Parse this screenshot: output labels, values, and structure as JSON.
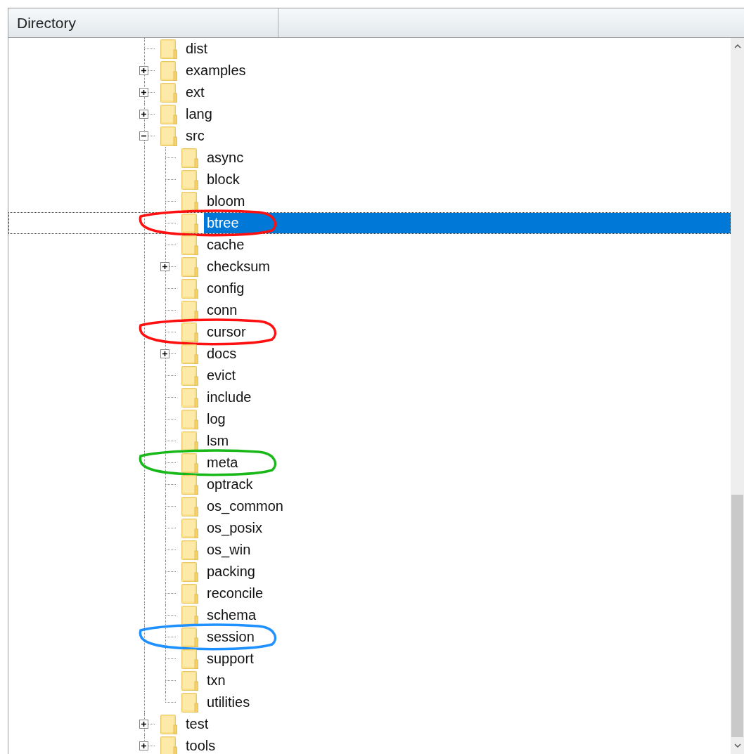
{
  "header": {
    "columns": [
      "Directory"
    ]
  },
  "tree": {
    "items": [
      {
        "name": "dist",
        "selected": false
      },
      {
        "name": "examples",
        "expanded": false,
        "selected": false
      },
      {
        "name": "ext",
        "expanded": false,
        "selected": false
      },
      {
        "name": "lang",
        "expanded": false,
        "selected": false
      },
      {
        "name": "src",
        "expanded": true,
        "selected": false,
        "children": [
          {
            "name": "async",
            "selected": false
          },
          {
            "name": "block",
            "selected": false
          },
          {
            "name": "bloom",
            "selected": false
          },
          {
            "name": "btree",
            "selected": true,
            "circle": {
              "color": "#ff1010"
            }
          },
          {
            "name": "cache",
            "selected": false
          },
          {
            "name": "checksum",
            "expanded": false,
            "selected": false
          },
          {
            "name": "config",
            "selected": false
          },
          {
            "name": "conn",
            "selected": false
          },
          {
            "name": "cursor",
            "selected": false,
            "circle": {
              "color": "#ff1010"
            }
          },
          {
            "name": "docs",
            "expanded": false,
            "selected": false
          },
          {
            "name": "evict",
            "selected": false
          },
          {
            "name": "include",
            "selected": false
          },
          {
            "name": "log",
            "selected": false
          },
          {
            "name": "lsm",
            "selected": false
          },
          {
            "name": "meta",
            "selected": false,
            "circle": {
              "color": "#18b818"
            }
          },
          {
            "name": "optrack",
            "selected": false
          },
          {
            "name": "os_common",
            "selected": false
          },
          {
            "name": "os_posix",
            "selected": false
          },
          {
            "name": "os_win",
            "selected": false
          },
          {
            "name": "packing",
            "selected": false
          },
          {
            "name": "reconcile",
            "selected": false
          },
          {
            "name": "schema",
            "selected": false
          },
          {
            "name": "session",
            "selected": false,
            "circle": {
              "color": "#1e90ff"
            }
          },
          {
            "name": "support",
            "selected": false
          },
          {
            "name": "txn",
            "selected": false
          },
          {
            "name": "utilities",
            "selected": false
          }
        ]
      },
      {
        "name": "test",
        "expanded": false,
        "selected": false
      },
      {
        "name": "tools",
        "expanded": false,
        "selected": false
      }
    ]
  }
}
